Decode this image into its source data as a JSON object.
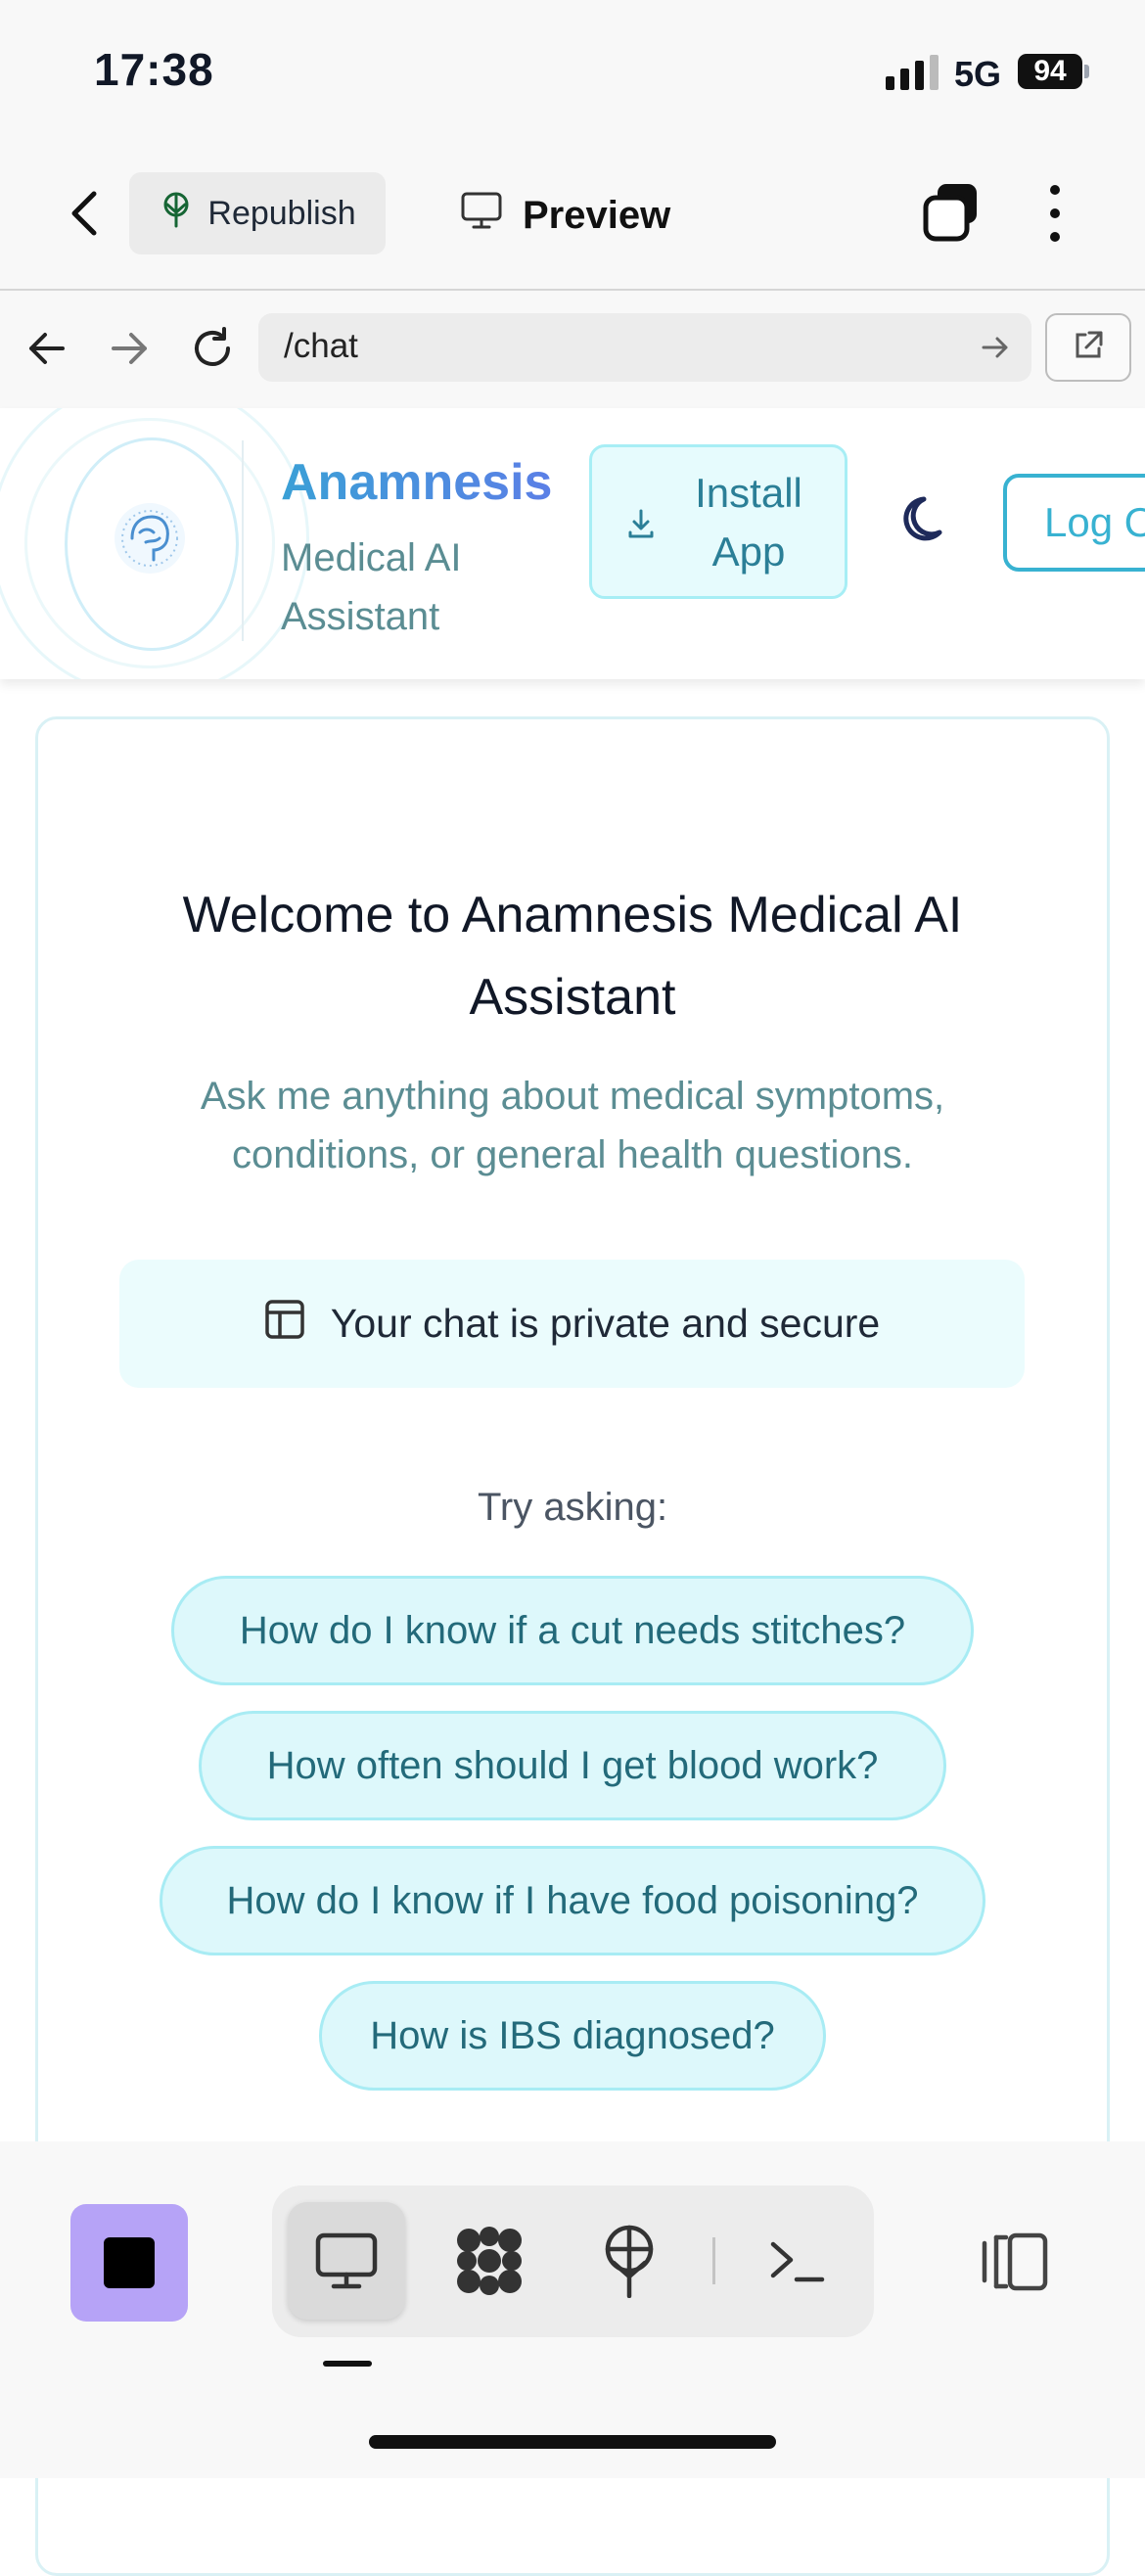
{
  "status_bar": {
    "time": "17:38",
    "network": "5G",
    "battery": "94"
  },
  "toolbar": {
    "republish_label": "Republish",
    "preview_label": "Preview"
  },
  "browser": {
    "url": "/chat"
  },
  "site_header": {
    "brand": "Anamnesis",
    "tagline": "Medical AI Assistant",
    "install_label": "Install App",
    "login_label": "Log Out"
  },
  "chat": {
    "welcome_title": "Welcome to Anamnesis Medical AI Assistant",
    "subtitle": "Ask me anything about medical symptoms, conditions, or general health questions.",
    "privacy_note": "Your chat is private and secure",
    "try_label": "Try asking:",
    "suggestions": [
      "How do I know if a cut needs stitches?",
      "How often should I get blood work?",
      "How do I know if I have food poisoning?",
      "How is IBS diagnosed?"
    ]
  },
  "colors": {
    "brand_gradient_start": "#3aa0d6",
    "brand_gradient_end": "#5b7fe6",
    "accent_cyan": "#38b2d1",
    "stop_button": "#b6a3f7",
    "pill_bg": "#ddf8fb"
  },
  "icons": {
    "toolbar": [
      "back-chevron-icon",
      "sprout-icon",
      "monitor-icon",
      "tabs-icon",
      "more-vertical-icon"
    ],
    "browser": [
      "arrow-left-icon",
      "arrow-right-icon",
      "reload-icon",
      "go-arrow-icon",
      "external-link-icon"
    ],
    "bottom": [
      "stop-icon",
      "monitor-icon",
      "pattern-icon",
      "deploy-icon",
      "terminal-icon",
      "panel-toggle-icon"
    ]
  }
}
